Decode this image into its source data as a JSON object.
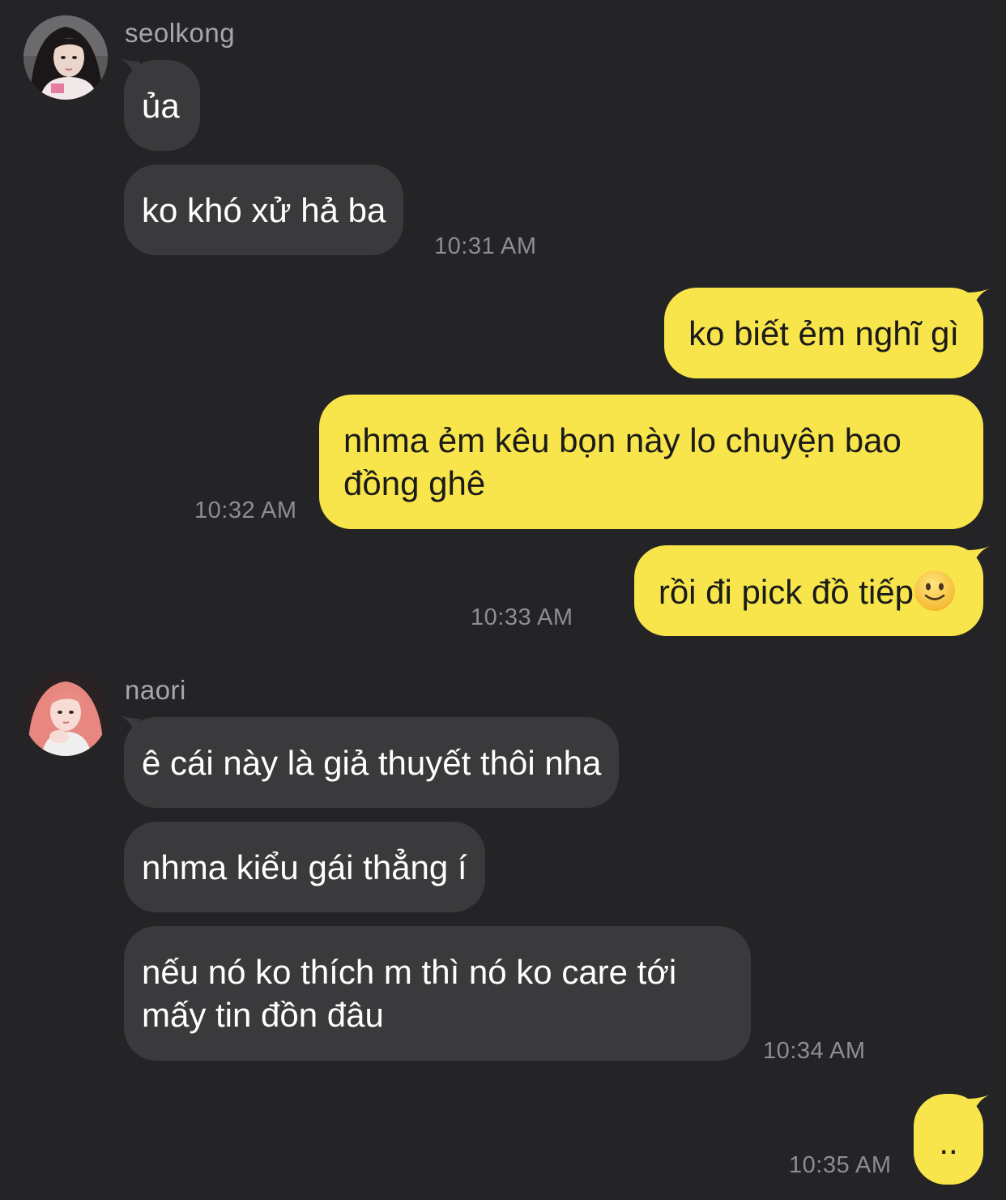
{
  "theme": {
    "background": "#242426",
    "incoming_bubble": "#3a3a3c",
    "outgoing_bubble": "#f8e54b",
    "timestamp_color": "#8d8d92"
  },
  "messages": {
    "group1": {
      "sender": "seolkong",
      "avatar": "profile-photo",
      "msg1": "ủa",
      "msg2": "ko khó xử hả ba",
      "time": "10:31 AM"
    },
    "out1": {
      "msg1": "ko biết ẻm nghĩ gì",
      "msg2_line1": "nhma ẻm kêu bọn này lo chuyện bao",
      "msg2_line2": "đồng ghê",
      "time1": "10:32 AM",
      "msg3": "rồi đi pick đồ tiếp",
      "msg3_emoji": "slightly-smiling-face-icon",
      "time2": "10:33 AM"
    },
    "group2": {
      "sender": "naori",
      "avatar": "profile-photo",
      "msg1": "ê cái này là giả thuyết thôi nha",
      "msg2": "nhma kiểu gái thẳng í",
      "msg3_line1": "nếu nó ko thích m thì nó ko care tới",
      "msg3_line2": "mấy tin đồn đâu",
      "time": "10:34 AM"
    },
    "out2": {
      "msg1": "..",
      "time": "10:35 AM"
    }
  }
}
